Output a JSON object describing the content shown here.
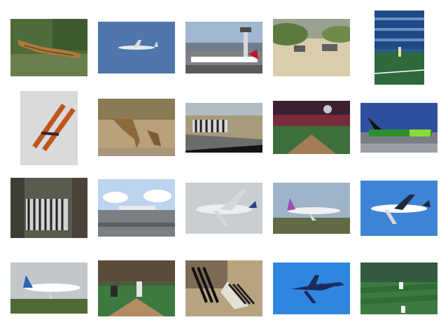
{
  "grid": {
    "tiles": [
      {
        "subject": "giraffes"
      },
      {
        "subject": "airplane"
      },
      {
        "subject": "airplane"
      },
      {
        "subject": "zebras"
      },
      {
        "subject": "tennis"
      },
      {
        "subject": "airplane"
      },
      {
        "subject": "giraffe"
      },
      {
        "subject": "zebra"
      },
      {
        "subject": "baseball"
      },
      {
        "subject": "airplane"
      },
      {
        "subject": "zebras"
      },
      {
        "subject": "airplane"
      },
      {
        "subject": "airplane"
      },
      {
        "subject": "airplane"
      },
      {
        "subject": "airplane"
      },
      {
        "subject": "airplane"
      },
      {
        "subject": "baseball"
      },
      {
        "subject": "zebra"
      },
      {
        "subject": "airplane"
      },
      {
        "subject": "baseball"
      }
    ]
  }
}
